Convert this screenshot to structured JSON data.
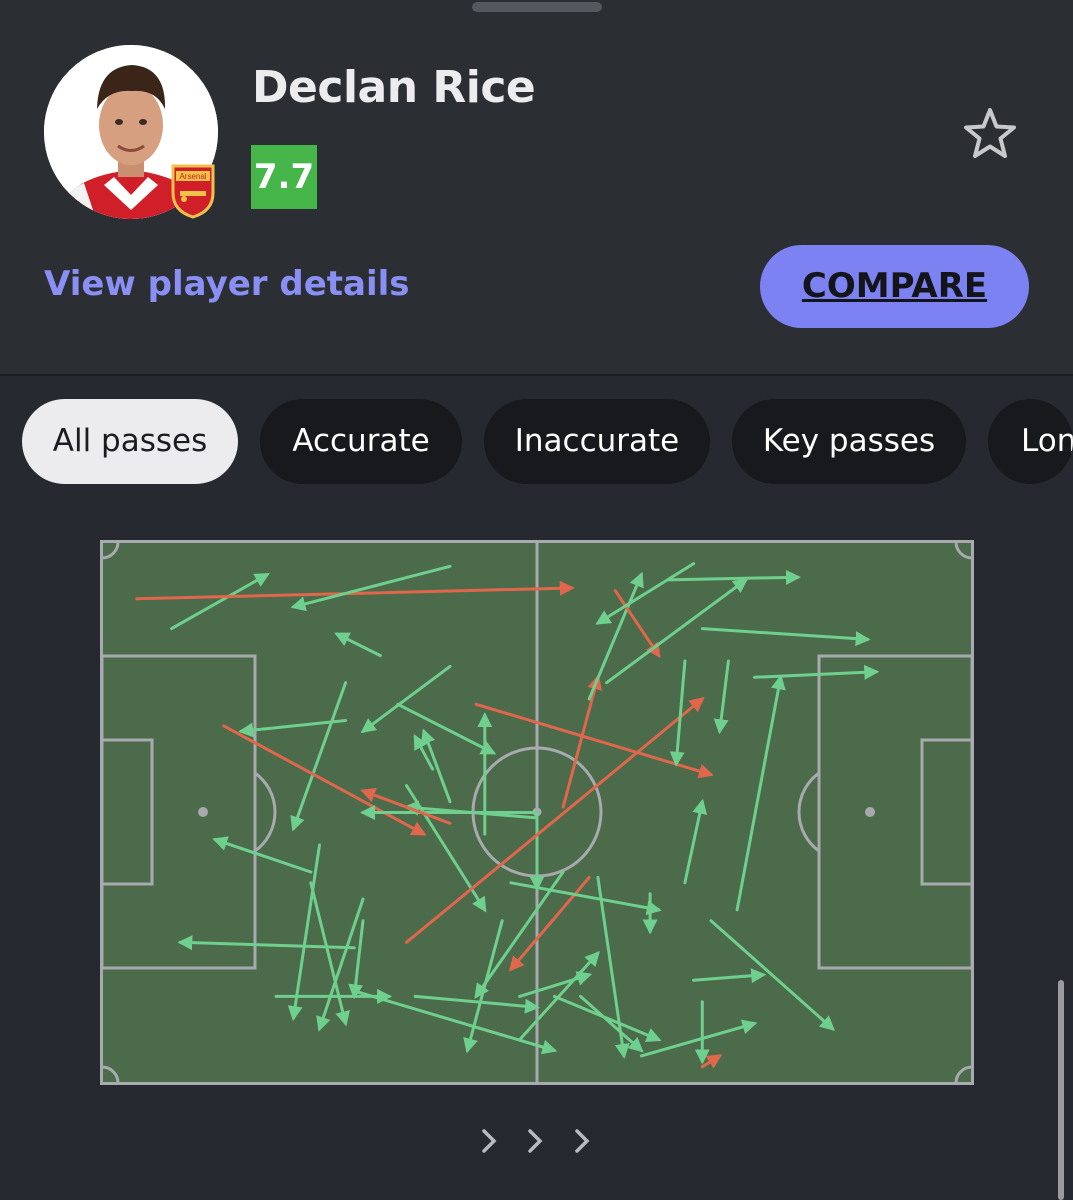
{
  "player": {
    "name": "Declan Rice",
    "rating": "7.7",
    "rating_color": "#46b64a",
    "club_badge_text": "Arsenal"
  },
  "actions": {
    "view_details": "View player details",
    "compare": "COMPARE"
  },
  "filters": [
    {
      "label": "All passes",
      "active": true
    },
    {
      "label": "Accurate",
      "active": false
    },
    {
      "label": "Inaccurate",
      "active": false
    },
    {
      "label": "Key passes",
      "active": false
    },
    {
      "label": "Lon",
      "active": false
    }
  ],
  "colors": {
    "accent": "#7c82f2",
    "accurate_pass": "#6fcf8e",
    "inaccurate_pass": "#e0664c",
    "pitch": "#4b6b4a"
  },
  "pass_map": {
    "passes": [
      [
        0.08,
        0.16,
        0.19,
        0.06,
        "acc"
      ],
      [
        0.04,
        0.105,
        0.54,
        0.085,
        "inacc"
      ],
      [
        0.4,
        0.045,
        0.22,
        0.12,
        "acc"
      ],
      [
        0.32,
        0.21,
        0.27,
        0.17,
        "acc"
      ],
      [
        0.4,
        0.23,
        0.3,
        0.35,
        "acc"
      ],
      [
        0.28,
        0.33,
        0.16,
        0.35,
        "acc"
      ],
      [
        0.28,
        0.26,
        0.22,
        0.53,
        "acc"
      ],
      [
        0.14,
        0.34,
        0.37,
        0.54,
        "inacc"
      ],
      [
        0.35,
        0.45,
        0.44,
        0.68,
        "acc"
      ],
      [
        0.5,
        0.5,
        0.3,
        0.5,
        "acc"
      ],
      [
        0.5,
        0.51,
        0.35,
        0.49,
        "acc"
      ],
      [
        0.4,
        0.52,
        0.3,
        0.46,
        "inacc"
      ],
      [
        0.38,
        0.42,
        0.36,
        0.36,
        "acc"
      ],
      [
        0.4,
        0.48,
        0.37,
        0.35,
        "acc"
      ],
      [
        0.44,
        0.54,
        0.44,
        0.32,
        "acc"
      ],
      [
        0.24,
        0.61,
        0.13,
        0.55,
        "acc"
      ],
      [
        0.29,
        0.75,
        0.09,
        0.74,
        "acc"
      ],
      [
        0.25,
        0.56,
        0.22,
        0.88,
        "acc"
      ],
      [
        0.24,
        0.63,
        0.28,
        0.89,
        "acc"
      ],
      [
        0.3,
        0.66,
        0.25,
        0.9,
        "acc"
      ],
      [
        0.3,
        0.7,
        0.29,
        0.84,
        "acc"
      ],
      [
        0.2,
        0.84,
        0.33,
        0.84,
        "acc"
      ],
      [
        0.29,
        0.83,
        0.52,
        0.94,
        "acc"
      ],
      [
        0.46,
        0.7,
        0.42,
        0.94,
        "acc"
      ],
      [
        0.36,
        0.84,
        0.5,
        0.86,
        "acc"
      ],
      [
        0.53,
        0.61,
        0.43,
        0.84,
        "acc"
      ],
      [
        0.56,
        0.62,
        0.47,
        0.79,
        "inacc"
      ],
      [
        0.5,
        0.5,
        0.5,
        0.64,
        "acc"
      ],
      [
        0.35,
        0.74,
        0.69,
        0.29,
        "inacc"
      ],
      [
        0.43,
        0.3,
        0.7,
        0.43,
        "inacc"
      ],
      [
        0.53,
        0.49,
        0.57,
        0.25,
        "inacc"
      ],
      [
        0.56,
        0.29,
        0.62,
        0.06,
        "acc"
      ],
      [
        0.59,
        0.09,
        0.64,
        0.21,
        "inacc"
      ],
      [
        0.58,
        0.26,
        0.74,
        0.07,
        "acc"
      ],
      [
        0.65,
        0.07,
        0.8,
        0.065,
        "acc"
      ],
      [
        0.68,
        0.04,
        0.57,
        0.15,
        "acc"
      ],
      [
        0.69,
        0.16,
        0.88,
        0.18,
        "acc"
      ],
      [
        0.75,
        0.25,
        0.89,
        0.24,
        "acc"
      ],
      [
        0.72,
        0.22,
        0.71,
        0.35,
        "acc"
      ],
      [
        0.67,
        0.22,
        0.66,
        0.41,
        "acc"
      ],
      [
        0.67,
        0.63,
        0.69,
        0.48,
        "acc"
      ],
      [
        0.73,
        0.68,
        0.78,
        0.25,
        "acc"
      ],
      [
        0.47,
        0.63,
        0.64,
        0.68,
        "acc"
      ],
      [
        0.63,
        0.65,
        0.63,
        0.72,
        "acc"
      ],
      [
        0.7,
        0.7,
        0.84,
        0.9,
        "acc"
      ],
      [
        0.68,
        0.81,
        0.76,
        0.8,
        "acc"
      ],
      [
        0.62,
        0.95,
        0.75,
        0.89,
        "acc"
      ],
      [
        0.69,
        0.97,
        0.71,
        0.95,
        "inacc"
      ],
      [
        0.69,
        0.85,
        0.69,
        0.96,
        "acc"
      ],
      [
        0.57,
        0.62,
        0.6,
        0.95,
        "acc"
      ],
      [
        0.48,
        0.92,
        0.57,
        0.76,
        "acc"
      ],
      [
        0.48,
        0.84,
        0.56,
        0.8,
        "acc"
      ],
      [
        0.55,
        0.84,
        0.62,
        0.94,
        "acc"
      ],
      [
        0.52,
        0.84,
        0.64,
        0.92,
        "acc"
      ],
      [
        0.34,
        0.3,
        0.45,
        0.39,
        "acc"
      ]
    ]
  }
}
